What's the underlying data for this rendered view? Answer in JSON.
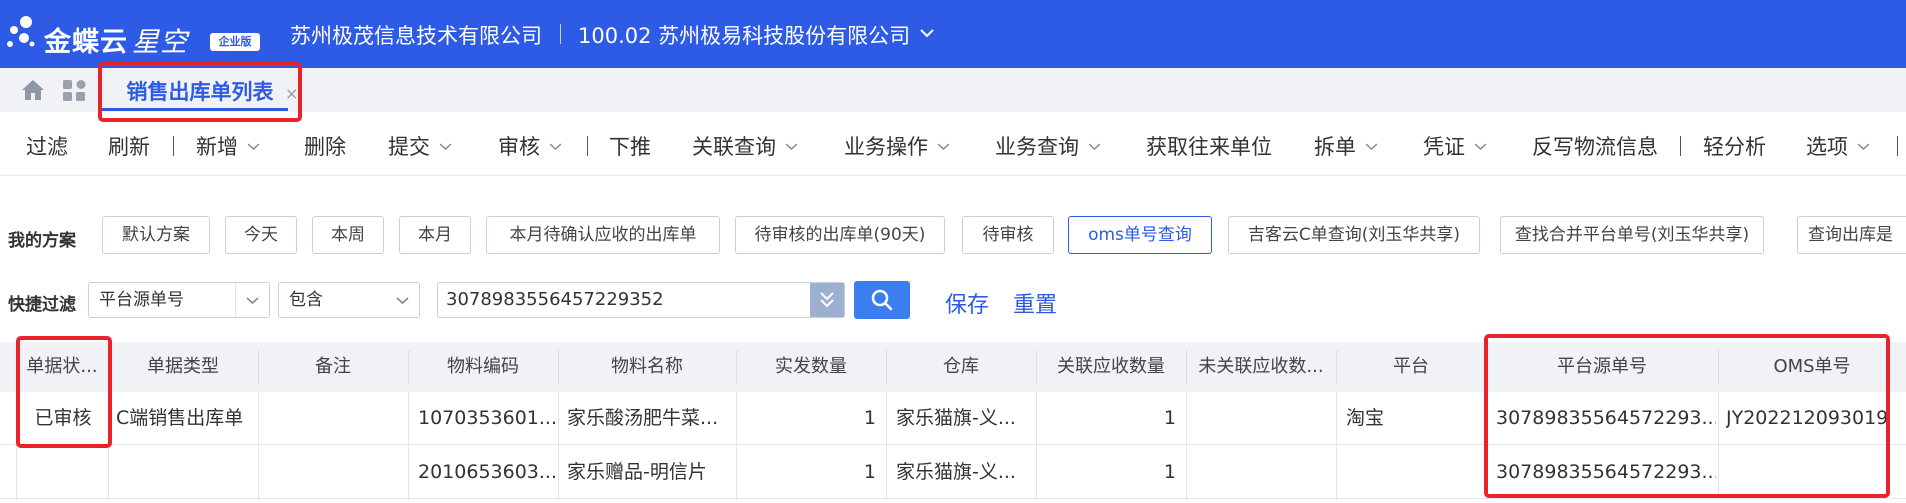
{
  "header": {
    "logo_text": "金蝶云",
    "logo_text2": "星空",
    "logo_badge": "企业版",
    "org1": "苏州极茂信息技术有限公司",
    "org2": "100.02 苏州极易科技股份有限公司"
  },
  "tabs": {
    "active_label": "销售出库单列表",
    "close": "×"
  },
  "toolbar": {
    "filter": "过滤",
    "refresh": "刷新",
    "add": "新增",
    "delete": "删除",
    "submit": "提交",
    "audit": "审核",
    "push_down": "下推",
    "related_query": "关联查询",
    "business_op": "业务操作",
    "business_query": "业务查询",
    "get_partner": "获取往来单位",
    "split": "拆单",
    "voucher": "凭证",
    "write_back": "反写物流信息",
    "light_analysis": "轻分析",
    "options": "选项"
  },
  "schemes": {
    "label": "我的方案",
    "items": [
      "默认方案",
      "今天",
      "本周",
      "本月",
      "本月待确认应收的出库单",
      "待审核的出库单(90天)",
      "待审核",
      "oms单号查询",
      "吉客云C单查询(刘玉华共享)",
      "查找合并平台单号(刘玉华共享)",
      "查询出库是"
    ]
  },
  "quick_filter": {
    "label": "快捷过滤",
    "field": "平台源单号",
    "operator": "包含",
    "value": "307898355645722935​2",
    "save": "保存",
    "reset": "重置"
  },
  "grid": {
    "columns": [
      "单据状...",
      "单据类型",
      "备注",
      "物料编码",
      "物料名称",
      "实发数量",
      "仓库",
      "关联应收数量",
      "未关联应收数...",
      "平台",
      "平台源单号",
      "OMS单号"
    ],
    "rows": [
      {
        "status": "已审核",
        "type": "C端销售出库单",
        "remark": "",
        "material_code": "1070353601...",
        "material_name": "家乐酸汤肥牛菜...",
        "qty": "1",
        "warehouse": "家乐猫旗-义...",
        "linked_qty": "1",
        "unlinked_qty": "",
        "platform": "淘宝",
        "source_no": "30789835564572293...",
        "oms_no": "JY202212093019"
      },
      {
        "status": "",
        "type": "",
        "remark": "",
        "material_code": "2010653603...",
        "material_name": "家乐赠品-明信片",
        "qty": "1",
        "warehouse": "家乐猫旗-义...",
        "linked_qty": "1",
        "unlinked_qty": "",
        "platform": "",
        "source_no": "30789835564572293...",
        "oms_no": ""
      }
    ]
  },
  "colors": {
    "brand": "#2d5be6",
    "highlight": "#e8232a"
  }
}
